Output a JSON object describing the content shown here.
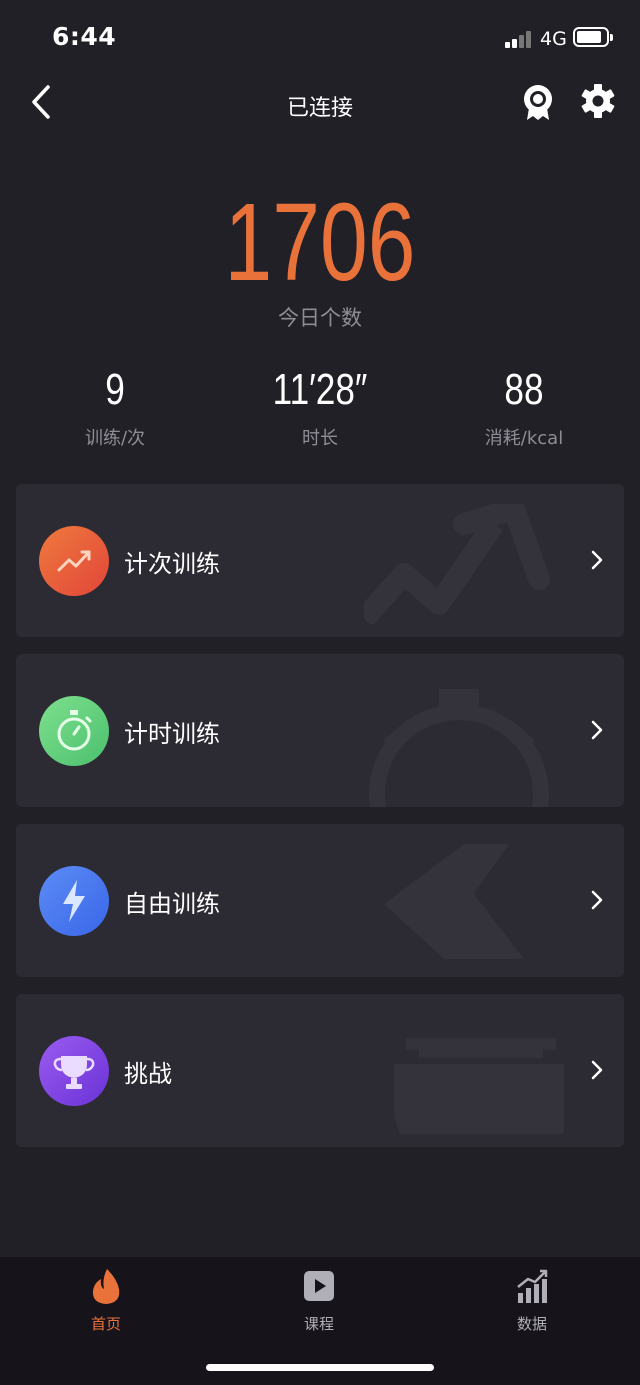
{
  "status_bar": {
    "time": "6:44",
    "network": "4G"
  },
  "nav": {
    "title": "已连接",
    "back_icon": "chevron-left-icon",
    "badge_icon": "medal-icon",
    "settings_icon": "gear-icon"
  },
  "hero": {
    "value": "1706",
    "label": "今日个数"
  },
  "stats": [
    {
      "value": "9",
      "label": "训练/次"
    },
    {
      "value": "11′28″",
      "label": "时长"
    },
    {
      "value": "88",
      "label": "消耗/kcal"
    }
  ],
  "cards": [
    {
      "label": "计次训练",
      "icon": "trend-up-icon",
      "color_from": "#ee7a3c",
      "color_to": "#e2453a"
    },
    {
      "label": "计时训练",
      "icon": "stopwatch-icon",
      "color_from": "#7ee08d",
      "color_to": "#4cc06f"
    },
    {
      "label": "自由训练",
      "icon": "lightning-icon",
      "color_from": "#5c8cf5",
      "color_to": "#3a66e8"
    },
    {
      "label": "挑战",
      "icon": "trophy-icon",
      "color_from": "#9a5cf0",
      "color_to": "#6a32d6"
    }
  ],
  "tabbar": {
    "items": [
      {
        "label": "首页",
        "icon": "flame-icon",
        "active": true
      },
      {
        "label": "课程",
        "icon": "play-icon",
        "active": false
      },
      {
        "label": "数据",
        "icon": "bar-chart-icon",
        "active": false
      }
    ],
    "active_color": "#e9723b",
    "inactive_color": "#b0aeb6"
  }
}
